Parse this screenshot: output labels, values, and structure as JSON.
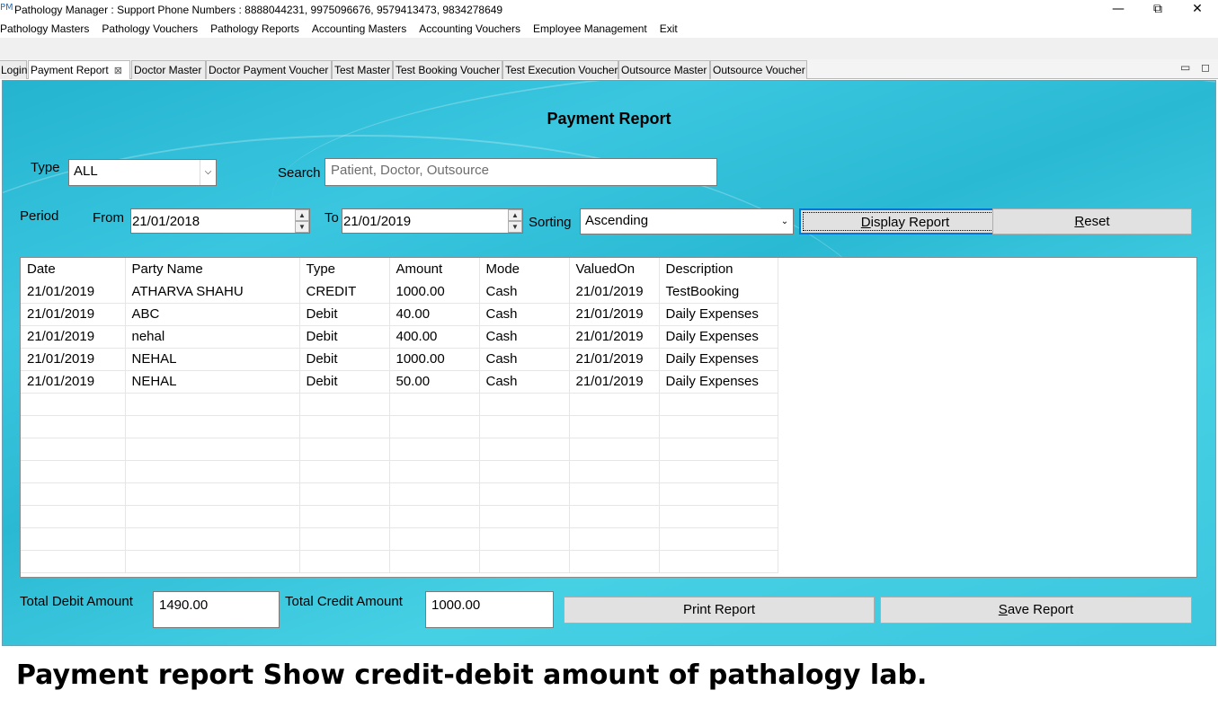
{
  "window": {
    "app_icon": "PM",
    "title": "Pathology Manager : Support Phone Numbers : 8888044231, 9975096676, 9579413473, 9834278649",
    "minimize": "—",
    "restore": "⧉",
    "close": "✕"
  },
  "menu": [
    "Pathology Masters",
    "Pathology Vouchers",
    "Pathology Reports",
    "Accounting Masters",
    "Accounting Vouchers",
    "Employee Management",
    "Exit"
  ],
  "tabs": [
    {
      "label": "Login",
      "active": false
    },
    {
      "label": "Payment Report",
      "active": true,
      "close": "⊠"
    },
    {
      "label": "Doctor Master",
      "active": false
    },
    {
      "label": "Doctor Payment Voucher",
      "active": false
    },
    {
      "label": "Test Master",
      "active": false
    },
    {
      "label": "Test Booking Voucher",
      "active": false
    },
    {
      "label": "Test Execution Voucher",
      "active": false
    },
    {
      "label": "Outsource Master",
      "active": false
    },
    {
      "label": "Outsource Voucher",
      "active": false
    }
  ],
  "view_controls": {
    "minimize": "▭",
    "maximize": "◻"
  },
  "form": {
    "title": "Payment Report",
    "type_label": "Type",
    "type_value": "ALL",
    "search_label": "Search",
    "search_placeholder": "Patient, Doctor, Outsource",
    "period_label": "Period",
    "from_label": "From",
    "from_value": "21/01/2018",
    "to_label": "To",
    "to_value": "21/01/2019",
    "sorting_label": "Sorting",
    "sorting_value": "Ascending",
    "display_button": {
      "mnemonic": "D",
      "rest": "isplay Report"
    },
    "reset_button": {
      "mnemonic": "R",
      "rest": "eset"
    }
  },
  "table": {
    "columns": [
      "Date",
      "Party Name",
      "Type",
      "Amount",
      "Mode",
      "ValuedOn",
      "Description"
    ],
    "rows": [
      [
        "21/01/2019",
        "ATHARVA SHAHU",
        "CREDIT",
        "1000.00",
        "Cash",
        "21/01/2019",
        "TestBooking"
      ],
      [
        "21/01/2019",
        "ABC",
        "Debit",
        "40.00",
        "Cash",
        "21/01/2019",
        "Daily Expenses"
      ],
      [
        "21/01/2019",
        "nehal",
        "Debit",
        "400.00",
        "Cash",
        "21/01/2019",
        "Daily Expenses"
      ],
      [
        "21/01/2019",
        "NEHAL",
        "Debit",
        "1000.00",
        "Cash",
        "21/01/2019",
        "Daily Expenses"
      ],
      [
        "21/01/2019",
        "NEHAL",
        "Debit",
        "50.00",
        "Cash",
        "21/01/2019",
        "Daily Expenses"
      ]
    ],
    "empty_rows": 8
  },
  "footer": {
    "total_debit_label": "Total Debit Amount",
    "total_debit_value": "1490.00",
    "total_credit_label": "Total Credit Amount",
    "total_credit_value": "1000.00",
    "print_button": "Print Report",
    "save_button": {
      "mnemonic": "S",
      "rest": "ave Report"
    }
  },
  "caption": "Payment report Show credit-debit amount of pathalogy lab."
}
